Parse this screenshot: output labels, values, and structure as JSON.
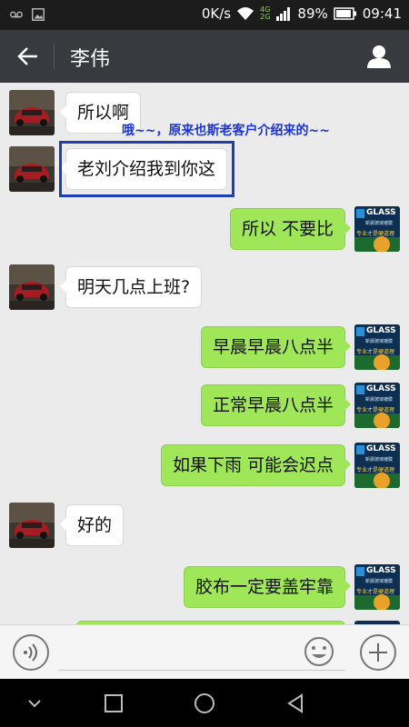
{
  "status_bar": {
    "network_speed": "0K/s",
    "network_type_top": "4G",
    "network_type_bottom": "2G",
    "battery": "89%",
    "time": "09:41"
  },
  "header": {
    "title": "李伟"
  },
  "annotation": {
    "text": "哦~~，原来也斯老客户介绍来的~~"
  },
  "messages": [
    {
      "side": "in",
      "text": "所以啊"
    },
    {
      "side": "in",
      "text": "老刘介绍我到你这"
    },
    {
      "side": "out",
      "text": "所以  不要比"
    },
    {
      "side": "in",
      "text": "明天几点上班?"
    },
    {
      "side": "out",
      "text": "早晨早晨八点半"
    },
    {
      "side": "out",
      "text": "正常早晨八点半"
    },
    {
      "side": "out",
      "text": "如果下雨  可能会迟点"
    },
    {
      "side": "in",
      "text": "好的"
    },
    {
      "side": "out",
      "text": "胶布一定要盖牢靠"
    }
  ],
  "avatar_text": {
    "brand": "GLASS",
    "line1": "新晨玻璃镀膜",
    "line2": "专业才是硬道理"
  },
  "colors": {
    "bubble_out": "#9fe658",
    "bubble_in": "#ffffff",
    "annotation": "#1a35d6",
    "title_bar": "#393a3f"
  }
}
